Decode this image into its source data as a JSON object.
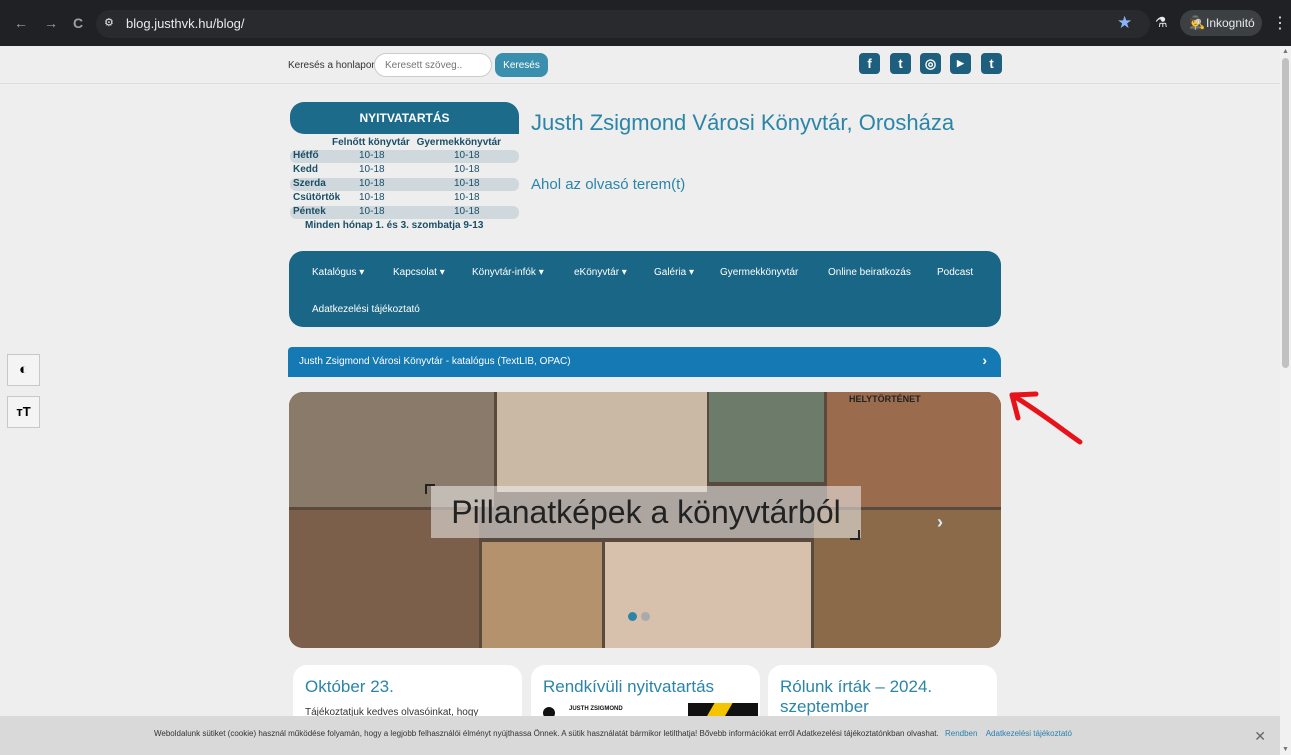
{
  "browser": {
    "url": "blog.justhvk.hu/blog/",
    "profile_label": "Inkognitó",
    "nav_back": "←",
    "nav_forward": "→",
    "nav_reload": "C",
    "site_info_icon": "⚙"
  },
  "search": {
    "label": "Keresés a honlapon",
    "placeholder": "Keresett szöveg..",
    "button": "Keresés"
  },
  "social": [
    {
      "icon": "facebook-icon",
      "glyph": "f"
    },
    {
      "icon": "twitter-icon",
      "glyph": "t"
    },
    {
      "icon": "instagram-icon",
      "glyph": "◎"
    },
    {
      "icon": "youtube-icon",
      "glyph": "▶"
    },
    {
      "icon": "tumblr-icon",
      "glyph": "t"
    }
  ],
  "hours": {
    "title": "NYITVATARTÁS",
    "col_adult": "Felnőtt könyvtár",
    "col_child": "Gyermekkönyvtár",
    "rows": [
      {
        "day": "Hétfő",
        "adult": "10-18",
        "child": "10-18"
      },
      {
        "day": "Kedd",
        "adult": "10-18",
        "child": "10-18"
      },
      {
        "day": "Szerda",
        "adult": "10-18",
        "child": "10-18"
      },
      {
        "day": "Csütörtök",
        "adult": "10-18",
        "child": "10-18"
      },
      {
        "day": "Péntek",
        "adult": "10-18",
        "child": "10-18"
      }
    ],
    "note": "Minden hónap 1. és 3. szombatja 9-13"
  },
  "site": {
    "title": "Justh Zsigmond Városi Könyvtár, Orosháza",
    "subtitle": "Ahol az olvasó terem(t)"
  },
  "nav": {
    "items": [
      "Katalógus ▾",
      "Kapcsolat ▾",
      "Könyvtár-infók ▾",
      "eKönyvtár ▾",
      "Galéria ▾",
      "Gyermekkönyvtár",
      "Online beiratkozás",
      "Podcast",
      "Adatkezelési tájékoztató"
    ]
  },
  "catalog_bar": {
    "text": "Justh Zsigmond Városi Könyvtár - katalógus (TextLIB, OPAC)",
    "chevron": "›"
  },
  "slider": {
    "caption": "Pillanatképek a könyvtárból",
    "sign_text": "HELYTÖRTÉNET",
    "next_arrow": "›"
  },
  "cards": [
    {
      "title": "Október 23.",
      "text": "Tájékoztatjuk kedves olvasóinkat, hogy"
    },
    {
      "title": "Rendkívüli nyitvatartás",
      "text": "JUSTH ZSIGMOND"
    },
    {
      "title": "Rólunk írták – 2024. szeptember",
      "text": ""
    }
  ],
  "accessibility": {
    "contrast_glyph": "◐",
    "fontsize_glyph": "тT"
  },
  "cookie": {
    "text": "Weboldalunk sütiket (cookie) használ működése folyamán, hogy a legjobb felhasználói élményt nyújthassa Önnek. A sütik használatát bármikor letilthatja! Bővebb információkat erről Adatkezelési tájékoztatónkban olvashat.",
    "accept": "Rendben",
    "privacy": "Adatkezelési tájékoztató",
    "close": "✕"
  },
  "colors": {
    "brand_dark": "#1a6686",
    "brand_light": "#2a85a8",
    "catalog_blue": "#1579b3",
    "annotation_red": "#e8121b"
  }
}
